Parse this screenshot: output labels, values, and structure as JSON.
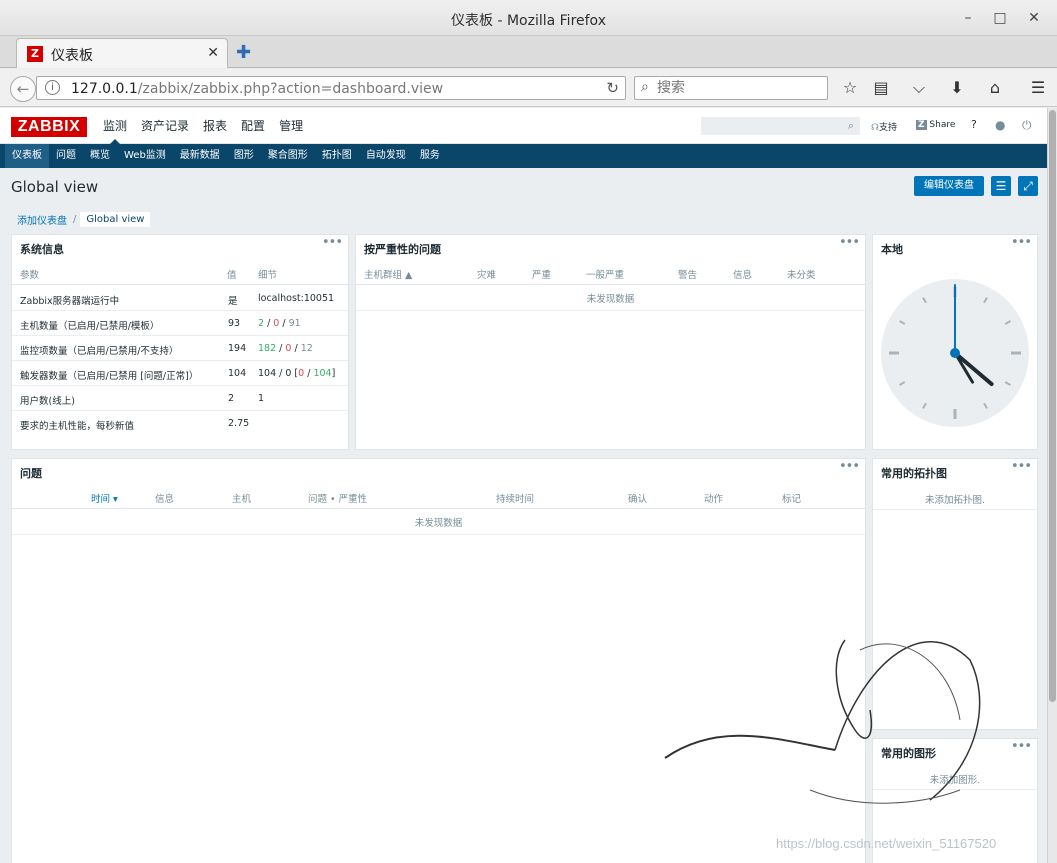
{
  "window": {
    "title": "仪表板 - Mozilla Firefox"
  },
  "browser": {
    "tab_title": "仪表板",
    "url_host": "127.0.0.1",
    "url_path": "/zabbix/zabbix.php?action=dashboard.view",
    "search_placeholder": "搜索"
  },
  "zabbix": {
    "logo": "ZABBIX",
    "top_menu": [
      "监测",
      "资产记录",
      "报表",
      "配置",
      "管理"
    ],
    "header_links": {
      "support": "支持",
      "share": "Share",
      "help": "?"
    },
    "sub_menu": [
      "仪表板",
      "问题",
      "概览",
      "Web监测",
      "最新数据",
      "图形",
      "聚合图形",
      "拓扑图",
      "自动发现",
      "服务"
    ]
  },
  "page": {
    "title": "Global view",
    "edit_button": "编辑仪表盘",
    "breadcrumb": [
      "添加仪表盘",
      "Global view"
    ]
  },
  "widgets": {
    "sysinfo": {
      "title": "系统信息",
      "columns": [
        "参数",
        "值",
        "细节"
      ],
      "rows": [
        {
          "param": "Zabbix服务器端运行中",
          "value": "是",
          "detail": "localhost:10051"
        },
        {
          "param": "主机数量（已启用/已禁用/模板）",
          "value": "93",
          "d1": "2",
          "d2": "0",
          "d3": "91"
        },
        {
          "param": "监控项数量（已启用/已禁用/不支持）",
          "value": "194",
          "d1": "182",
          "d2": "0",
          "d3": "12"
        },
        {
          "param": "触发器数量（已启用/已禁用 [问题/正常]）",
          "value": "104",
          "d1": "104 / 0 [",
          "d2": "0",
          "d3": "104",
          "d4": "]"
        },
        {
          "param": "用户数(线上)",
          "value": "2",
          "detail": "1"
        },
        {
          "param": "要求的主机性能，每秒新值",
          "value": "2.75",
          "detail": ""
        }
      ]
    },
    "severity": {
      "title": "按严重性的问题",
      "columns": [
        "主机群组 ▲",
        "灾难",
        "严重",
        "一般严重",
        "警告",
        "信息",
        "未分类"
      ],
      "empty": "未发现数据"
    },
    "clock": {
      "title": "本地",
      "hour": 4,
      "minute": 0,
      "second": 0
    },
    "problems": {
      "title": "问题",
      "columns": [
        "时间 ▾",
        "信息",
        "主机",
        "问题 • 严重性",
        "持续时间",
        "确认",
        "动作",
        "标记"
      ],
      "empty": "未发现数据"
    },
    "fav_maps": {
      "title": "常用的拓扑图",
      "empty": "未添加拓扑图."
    },
    "fav_graphs": {
      "title": "常用的图形",
      "empty": "未添加图形."
    }
  },
  "watermark": "https://blog.csdn.net/weixin_51167520"
}
